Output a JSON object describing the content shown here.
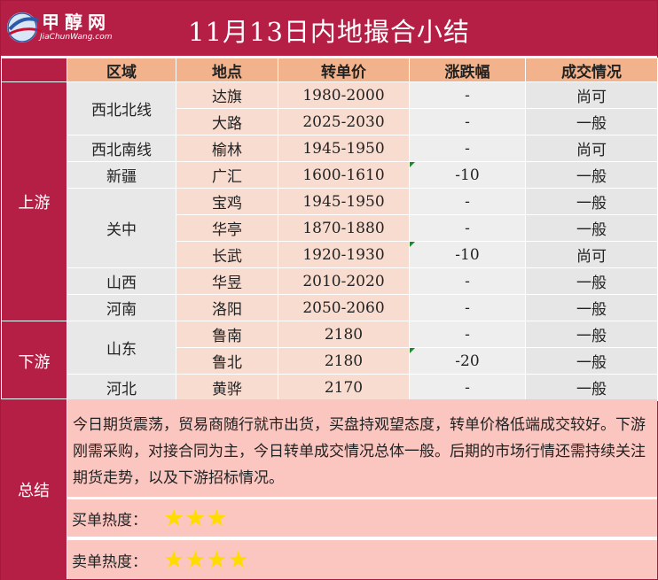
{
  "header": {
    "title": "11月13日内地撮合小结",
    "logo_brand": "甲醇网",
    "logo_url": "JiaChunWang.com"
  },
  "columns": [
    "区域",
    "地点",
    "转单价",
    "涨跌幅",
    "成交情况"
  ],
  "groups": {
    "upstream": "上游",
    "downstream": "下游",
    "summary": "总结"
  },
  "regions": {
    "xibei_bei": "西北北线",
    "xibei_nan": "西北南线",
    "xinjiang": "新疆",
    "guanzhong": "关中",
    "shanxi": "山西",
    "henan": "河南",
    "shandong": "山东",
    "hebei": "河北"
  },
  "rows": [
    {
      "place": "达旗",
      "price": "1980-2000",
      "change": "-",
      "deal": "尚可",
      "marker": false
    },
    {
      "place": "大路",
      "price": "2025-2030",
      "change": "-",
      "deal": "一般",
      "marker": false
    },
    {
      "place": "榆林",
      "price": "1945-1950",
      "change": "-",
      "deal": "尚可",
      "marker": false
    },
    {
      "place": "广汇",
      "price": "1600-1610",
      "change": "-10",
      "deal": "一般",
      "marker": true
    },
    {
      "place": "宝鸡",
      "price": "1945-1950",
      "change": "-",
      "deal": "一般",
      "marker": false
    },
    {
      "place": "华亭",
      "price": "1870-1880",
      "change": "-",
      "deal": "一般",
      "marker": false
    },
    {
      "place": "长武",
      "price": "1920-1930",
      "change": "-10",
      "deal": "尚可",
      "marker": true
    },
    {
      "place": "华昱",
      "price": "2010-2020",
      "change": "-",
      "deal": "一般",
      "marker": false
    },
    {
      "place": "洛阳",
      "price": "2050-2060",
      "change": "-",
      "deal": "一般",
      "marker": false
    },
    {
      "place": "鲁南",
      "price": "2180",
      "change": "-",
      "deal": "一般",
      "marker": false
    },
    {
      "place": "鲁北",
      "price": "2180",
      "change": "-20",
      "deal": "一般",
      "marker": true
    },
    {
      "place": "黄骅",
      "price": "2170",
      "change": "-",
      "deal": "一般",
      "marker": false
    }
  ],
  "summary": {
    "text": "今日期货震荡，贸易商随行就市出货，买盘持观望态度，转单价格低端成交较好。下游刚需采购，对接合同为主，今日转单成交情况总体一般。后期的市场行情还需持续关注期货走势，以及下游招标情况。",
    "buy_label": "买单热度：",
    "buy_stars": "★★★",
    "buy_rating": 3,
    "sell_label": "卖单热度：",
    "sell_stars": "★★★★",
    "sell_rating": 4
  },
  "colors": {
    "brand": "#b51f45",
    "header_cell": "#f1b28c",
    "summary_bg": "#fbc6c0",
    "star": "#ffdc00",
    "change_marker": "#1a8a2a"
  }
}
